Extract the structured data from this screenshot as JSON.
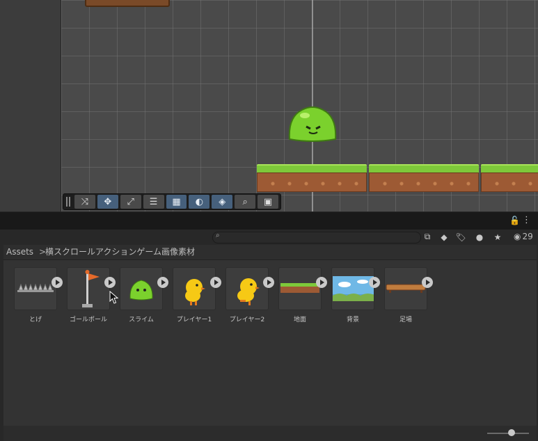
{
  "toolbar": {
    "tools": [
      {
        "icon": "shuffle-icon",
        "glyph": "⤨",
        "active": false
      },
      {
        "icon": "move-icon",
        "glyph": "✥",
        "active": true
      },
      {
        "icon": "scale-icon",
        "glyph": "⤢",
        "active": false
      },
      {
        "icon": "sliders-icon",
        "glyph": "☰",
        "active": false
      },
      {
        "icon": "grid-snap-icon",
        "glyph": "▦",
        "active": true
      },
      {
        "icon": "shading-icon",
        "glyph": "◐",
        "active": true
      },
      {
        "icon": "layers-icon",
        "glyph": "◈",
        "active": true
      },
      {
        "icon": "zoom-icon",
        "glyph": "⌕",
        "active": false
      },
      {
        "icon": "camera-icon",
        "glyph": "▣",
        "active": false
      }
    ]
  },
  "project_panel": {
    "search": {
      "value": "",
      "placeholder": ""
    },
    "hidden_count": "29",
    "breadcrumb": {
      "root": "Assets",
      "separator": ">",
      "folder": "横スクロールアクションゲーム画像素材"
    },
    "assets": [
      {
        "label": "とげ",
        "kind": "spikes"
      },
      {
        "label": "ゴールポール",
        "kind": "flag"
      },
      {
        "label": "スライム",
        "kind": "slime"
      },
      {
        "label": "プレイヤー1",
        "kind": "chick"
      },
      {
        "label": "プレイヤー2",
        "kind": "chick2"
      },
      {
        "label": "地面",
        "kind": "ground"
      },
      {
        "label": "背景",
        "kind": "background"
      },
      {
        "label": "足場",
        "kind": "plank"
      }
    ]
  },
  "colors": {
    "accent": "#46607c",
    "grass": "#7ec93a",
    "dirt": "#9d5a34",
    "slime": "#7bd12d"
  }
}
